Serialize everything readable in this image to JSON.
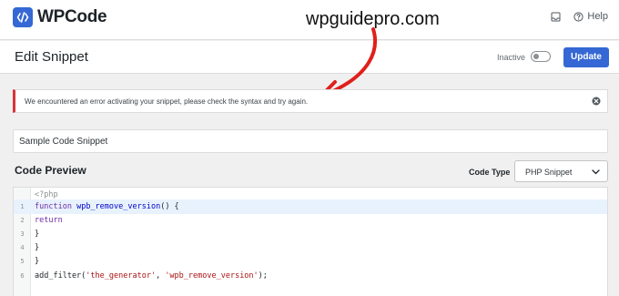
{
  "header": {
    "logo_text": "WPCode",
    "watermark": "wpguidepro.com",
    "help_label": "Help"
  },
  "edit_bar": {
    "title": "Edit Snippet",
    "status_label": "Inactive",
    "active": false,
    "update_label": "Update"
  },
  "notice": {
    "message": "We encountered an error activating your snippet, please check the syntax and try again."
  },
  "snippet": {
    "title_value": "Sample Code Snippet"
  },
  "code_preview": {
    "heading": "Code Preview",
    "code_type_label": "Code Type",
    "code_type_value": "PHP Snippet",
    "php_tag": "<?php",
    "lines": [
      {
        "num": "1",
        "kw": "function",
        "fn": "wpb_remove_version",
        "rest": "() {"
      },
      {
        "num": "2",
        "kw": "return",
        "fn": "",
        "rest": ""
      },
      {
        "num": "3",
        "kw": "",
        "fn": "",
        "rest": "}"
      },
      {
        "num": "4",
        "kw": "",
        "fn": "",
        "rest": "}"
      },
      {
        "num": "5",
        "kw": "",
        "fn": "",
        "rest": "}"
      },
      {
        "num": "6",
        "kw": "",
        "fn": "add_filter(",
        "str1": "'the_generator'",
        "sep": ", ",
        "str2": "'wpb_remove_version'",
        "rest": ");"
      }
    ]
  },
  "colors": {
    "brand": "#3568d4",
    "error": "#d63638",
    "annotation_arrow": "#e0201b"
  }
}
